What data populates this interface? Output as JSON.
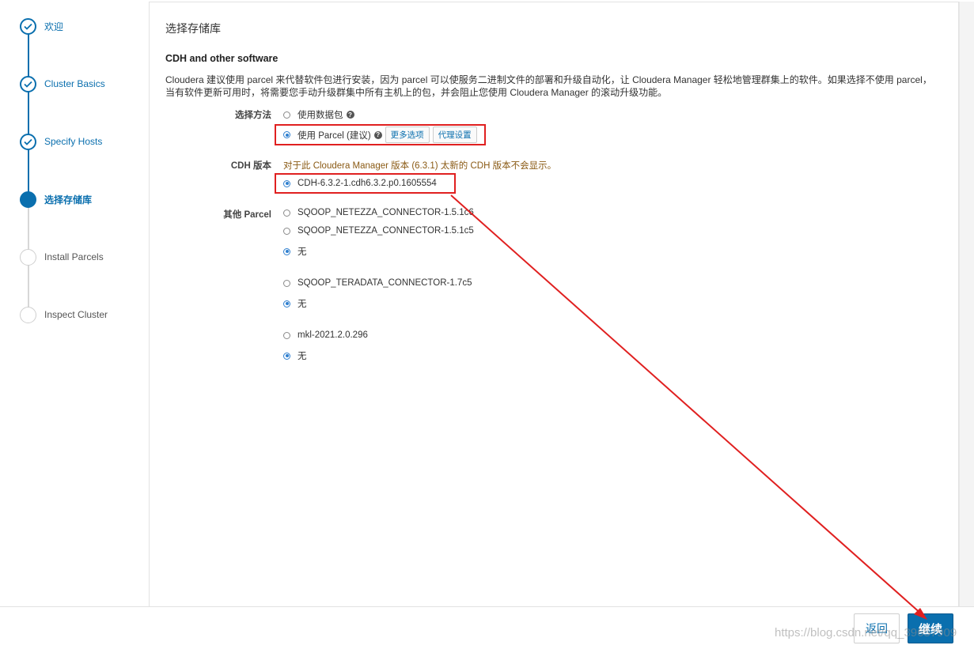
{
  "steps": [
    {
      "label": "欢迎",
      "state": "done"
    },
    {
      "label": "Cluster Basics",
      "state": "done"
    },
    {
      "label": "Specify Hosts",
      "state": "done"
    },
    {
      "label": "选择存储库",
      "state": "active"
    },
    {
      "label": "Install Parcels",
      "state": "todo"
    },
    {
      "label": "Inspect Cluster",
      "state": "todo"
    }
  ],
  "main": {
    "page_title": "选择存储库",
    "section_title": "CDH and other software",
    "description": "Cloudera 建议使用 parcel 来代替软件包进行安装，因为 parcel 可以使服务二进制文件的部署和升级自动化，让 Cloudera Manager 轻松地管理群集上的软件。如果选择不使用 parcel，当有软件更新可用时，将需要您手动升级群集中所有主机上的包，并会阻止您使用 Cloudera Manager 的滚动升级功能。",
    "method": {
      "label": "选择方法",
      "option_packages": "使用数据包",
      "option_parcel": "使用 Parcel (建议)",
      "more_options": "更多选项",
      "proxy_settings": "代理设置"
    },
    "cdh": {
      "label": "CDH 版本",
      "warning": "对于此 Cloudera Manager 版本 (6.3.1) 太新的 CDH 版本不会显示。",
      "version": "CDH-6.3.2-1.cdh6.3.2.p0.1605554"
    },
    "other": {
      "label": "其他 Parcel",
      "groups": [
        {
          "options": [
            "SQOOP_NETEZZA_CONNECTOR-1.5.1c6",
            "SQOOP_NETEZZA_CONNECTOR-1.5.1c5",
            "无"
          ],
          "selected": 2
        },
        {
          "options": [
            "SQOOP_TERADATA_CONNECTOR-1.7c5",
            "无"
          ],
          "selected": 1
        },
        {
          "options": [
            "mkl-2021.2.0.296",
            "无"
          ],
          "selected": 1
        }
      ]
    }
  },
  "footer": {
    "back": "返回",
    "next": "继续",
    "watermark": "https://blog.csdn.net/qq_39657909"
  },
  "colors": {
    "accent": "#0a6fae",
    "annotation": "#e02020"
  }
}
